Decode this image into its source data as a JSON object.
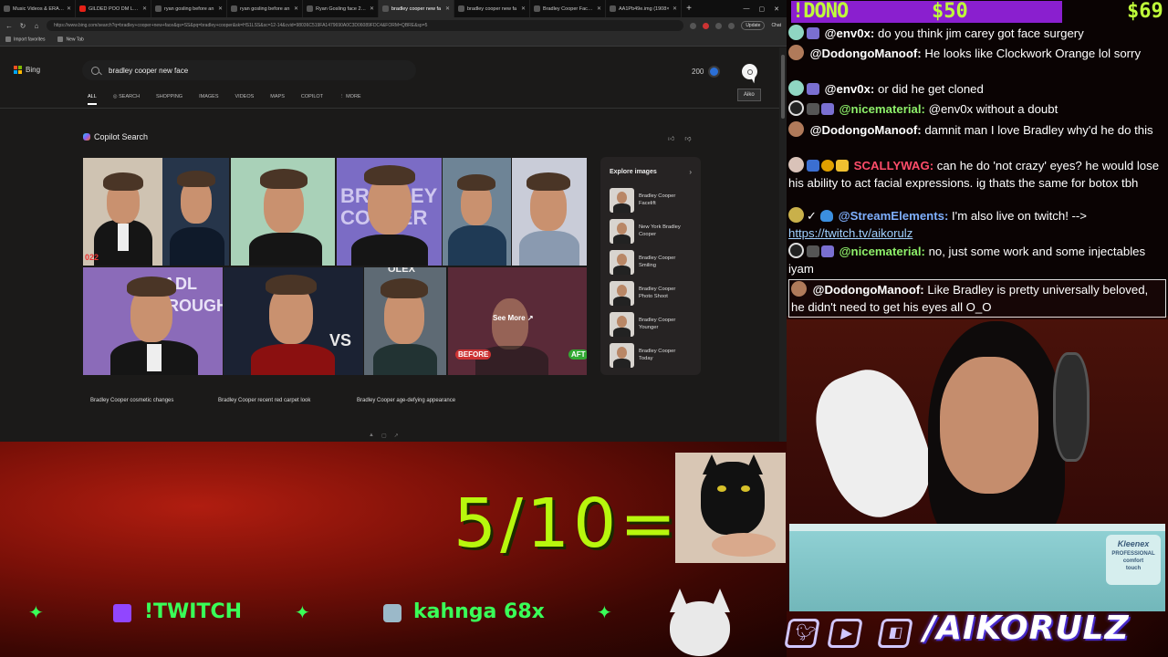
{
  "browser": {
    "tabs": [
      {
        "label": "Music Videos & ERASER",
        "active": false
      },
      {
        "label": "GILDED POO DM LEAKE",
        "active": false
      },
      {
        "label": "ryan gosling before an",
        "active": false
      },
      {
        "label": "ryan gosling before an",
        "active": false
      },
      {
        "label": "Ryan Gosling face 2023",
        "active": false
      },
      {
        "label": "bradley cooper new fa",
        "active": true
      },
      {
        "label": "bradley cooper new fa",
        "active": false
      },
      {
        "label": "Bradley Cooper Facelift",
        "active": false
      },
      {
        "label": "AA1Pb49e.img (1908×",
        "active": false
      }
    ],
    "url": "https://www.bing.com/search?q=bradley+cooper+new+face&qs=SS&pq=bradley+cooper&sk=HS1LSS&sc=12-14&cvid=98036C519FA1479690A0C3D06089FDC4&FORM=QBRE&sp=5",
    "update_label": "Update",
    "chat_label": "Chat",
    "favorites": [
      "Import favorites",
      "New Tab"
    ]
  },
  "bing": {
    "logo": "Bing",
    "search_query": "bradley cooper new face",
    "rewards_count": "200",
    "avatar_tooltip": "Aiko",
    "tabs": [
      "ALL",
      "SEARCH",
      "SHOPPING",
      "IMAGES",
      "VIDEOS",
      "MAPS",
      "COPILOT",
      "MORE"
    ],
    "copilot_title": "Copilot Search",
    "see_more": "See More",
    "explore_title": "Explore images",
    "explore_items": [
      {
        "l1": "Bradley Cooper",
        "l2": "Facelift"
      },
      {
        "l1": "New York Bradley",
        "l2": "Cooper"
      },
      {
        "l1": "Bradley Cooper",
        "l2": "Smiling"
      },
      {
        "l1": "Bradley Cooper",
        "l2": "Photo Shoot"
      },
      {
        "l1": "Bradley Cooper",
        "l2": "Younger"
      },
      {
        "l1": "Bradley Cooper",
        "l2": "Today"
      }
    ],
    "related": [
      "Bradley Cooper cosmetic changes",
      "Bradley Cooper recent red carpet look",
      "Bradley Cooper age-defying appearance"
    ],
    "image_labels": {
      "year": "022",
      "poster_a": "BRADLEY COOPER",
      "before": "BEFORE",
      "after": "AFT",
      "bradley": "BRADL",
      "trough": "ROUGH",
      "vs": "VS",
      "olex": "OLEX"
    }
  },
  "overlay": {
    "score": "5/10=",
    "ticker": [
      "!TWITCH",
      "kahnga 68x"
    ],
    "social_handle": "/AIKORULZ",
    "social_icons": [
      "twitter-icon",
      "youtube-icon",
      "twitch-icon"
    ],
    "dono_command": "!DONO",
    "dono_amount": "$50",
    "dono_right": "$69",
    "kleenex": {
      "brand": "Kleenex",
      "line1": "PROFESSIONAL",
      "line2": "comfort",
      "line3": "touch"
    }
  },
  "chat": [
    {
      "user": "@env0x:",
      "text": "do you think jim carey got face surgery",
      "color": "#ffffff"
    },
    {
      "user": "@DodongoManoof:",
      "text": "He looks like Clockwork Orange lol sorry",
      "color": "#ffffff"
    },
    {
      "user": "@env0x:",
      "text": "or did he get cloned",
      "color": "#ffffff"
    },
    {
      "user": "@nicematerial:",
      "text": "@env0x without a doubt",
      "color": "#8ef06a"
    },
    {
      "user": "@DodongoManoof:",
      "text": "damnit man I love Bradley why'd he do this",
      "color": "#ffffff"
    },
    {
      "user": "SCALLYWAG:",
      "text": "can he do 'not crazy' eyes? he would lose his ability to act facial expressions. ig thats the same for botox tbh",
      "color": "#ff4d6a"
    },
    {
      "user": "@StreamElements:",
      "text": "I'm also live on twitch! -->",
      "link": "https://twitch.tv/aikorulz",
      "color": "#7fb0ff"
    },
    {
      "user": "@nicematerial:",
      "text": "no, just some work and some injectables iyam",
      "color": "#8ef06a"
    },
    {
      "user": "@DodongoManoof:",
      "text": "Like Bradley is pretty universally beloved, he didn't need to get his eyes all O_O",
      "color": "#ffffff"
    }
  ]
}
